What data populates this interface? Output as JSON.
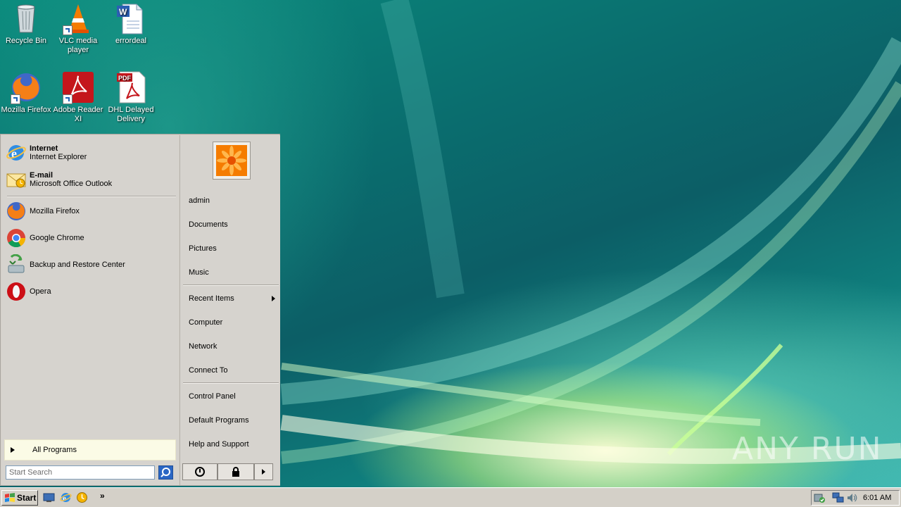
{
  "desktop": {
    "icons": [
      {
        "label": "Recycle Bin"
      },
      {
        "label": "VLC media player"
      },
      {
        "label": "errordeal"
      },
      {
        "label": "Mozilla Firefox"
      },
      {
        "label": "Adobe Reader XI"
      },
      {
        "label": "DHL Delayed Delivery"
      }
    ],
    "watermark": "ANY RUN"
  },
  "start_menu": {
    "pinned": [
      {
        "title": "Internet",
        "subtitle": "Internet Explorer"
      },
      {
        "title": "E-mail",
        "subtitle": "Microsoft Office Outlook"
      }
    ],
    "recent": [
      {
        "label": "Mozilla Firefox"
      },
      {
        "label": "Google Chrome"
      },
      {
        "label": "Backup and Restore Center"
      },
      {
        "label": "Opera"
      }
    ],
    "all_programs": "All Programs",
    "search_placeholder": "Start Search",
    "right": {
      "user": "admin",
      "documents": "Documents",
      "pictures": "Pictures",
      "music": "Music",
      "recent_items": "Recent Items",
      "computer": "Computer",
      "network": "Network",
      "connect_to": "Connect To",
      "control_panel": "Control Panel",
      "default_programs": "Default Programs",
      "help_support": "Help and Support"
    }
  },
  "taskbar": {
    "start_label": "Start",
    "overflow": "»",
    "clock": "6:01 AM"
  }
}
